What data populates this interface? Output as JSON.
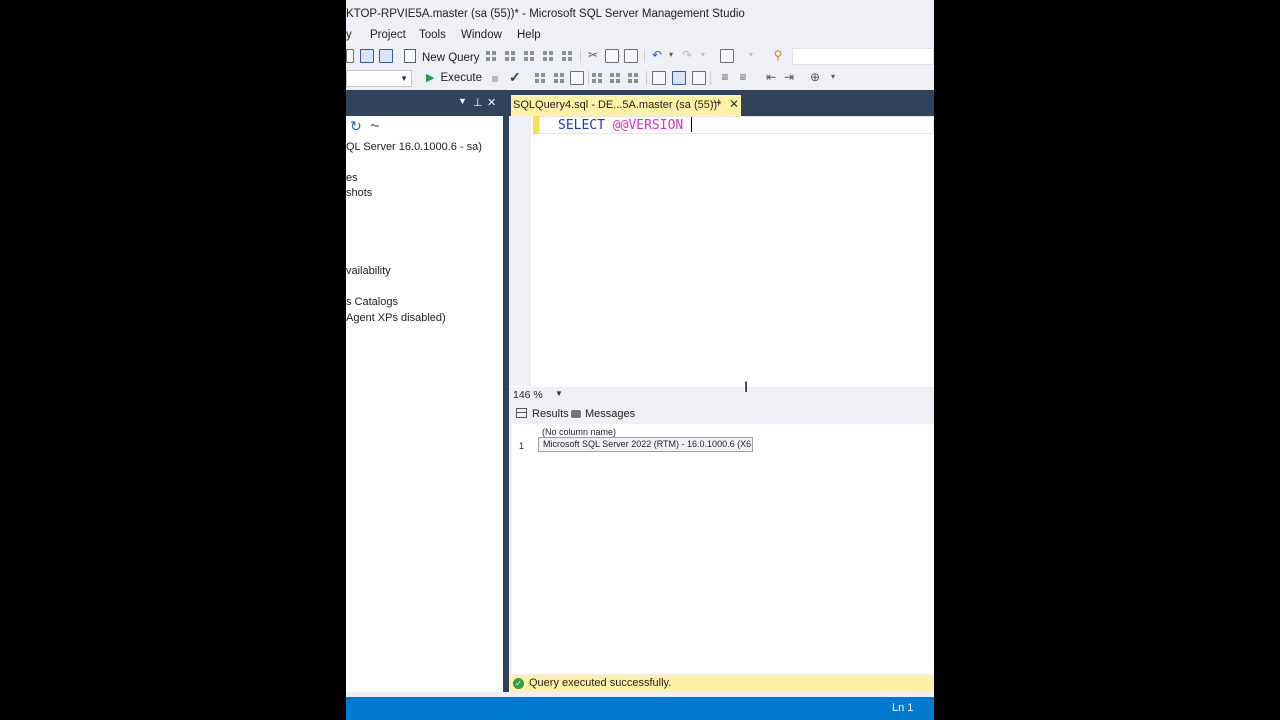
{
  "window": {
    "title": "KTOP-RPVIE5A.master (sa (55))* - Microsoft SQL Server Management Studio"
  },
  "menu": {
    "items": [
      "y",
      "Project",
      "Tools",
      "Window",
      "Help"
    ]
  },
  "toolbar": {
    "new_query_label": "New Query",
    "execute_label": "Execute"
  },
  "object_explorer": {
    "server_node": "QL Server 16.0.1000.6 - sa)",
    "nodes": [
      "es",
      "shots",
      "vailability",
      "s Catalogs",
      "Agent XPs disabled)"
    ]
  },
  "editor": {
    "tab_label": "SQLQuery4.sql - DE...5A.master (sa (55))*",
    "code_keyword": "SELECT",
    "code_variable": "@@VERSION",
    "zoom": "146 %"
  },
  "results": {
    "tabs": [
      "Results",
      "Messages"
    ],
    "column_header": "(No column name)",
    "row_number": "1",
    "cell_value": "Microsoft SQL Server 2022 (RTM) - 16.0.1000.6 (X6..."
  },
  "status": {
    "query_message": "Query executed successfully.",
    "line": "Ln 1"
  },
  "colors": {
    "dark_header": "#30425c",
    "accent_yellow": "#fff1a6",
    "status_blue": "#007acc",
    "sql_keyword": "#1d35d1",
    "sql_variable": "#d634c8",
    "success_green": "#2e9e4a"
  }
}
